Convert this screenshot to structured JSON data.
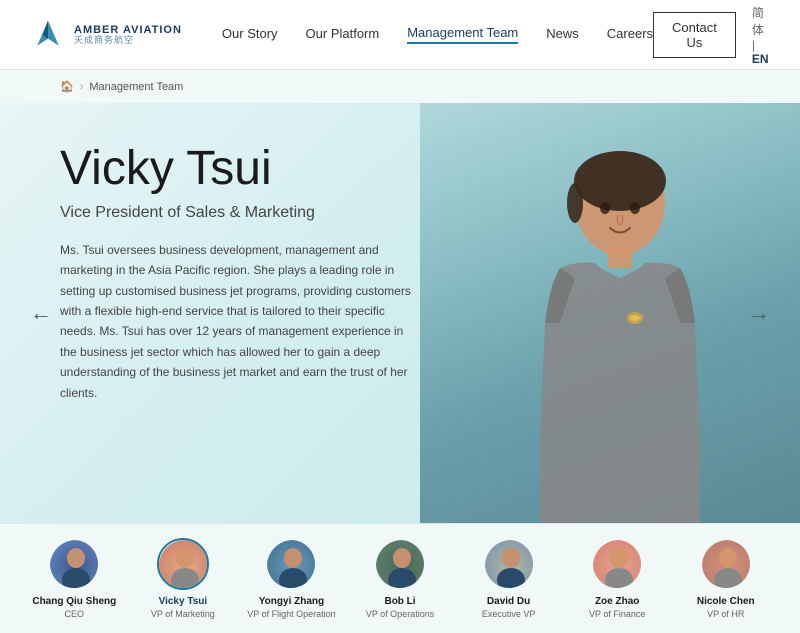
{
  "header": {
    "logo_en": "AMBER AVIATION",
    "logo_cn": "天成商务航空",
    "nav_items": [
      {
        "label": "Our Story",
        "active": false
      },
      {
        "label": "Our Platform",
        "active": false
      },
      {
        "label": "Management Team",
        "active": true
      },
      {
        "label": "News",
        "active": false
      },
      {
        "label": "Careers",
        "active": false
      }
    ],
    "contact_btn": "Contact Us",
    "lang_cn": "简体",
    "lang_sep": "|",
    "lang_en": "EN"
  },
  "breadcrumb": {
    "home": "🏠",
    "sep": ">",
    "current": "Management Team"
  },
  "profile": {
    "name": "Vicky Tsui",
    "title": "Vice President of Sales & Marketing",
    "bio": "Ms. Tsui oversees business development, management and marketing in the Asia Pacific region. She plays a leading role in setting up customised business jet programs, providing customers with a flexible high-end service that is tailored to their specific needs. Ms. Tsui has over 12 years of management experience in the business jet sector which has allowed her to gain a deep understanding of the business jet market and earn the trust of her clients."
  },
  "team": [
    {
      "name": "Chang Qiu Sheng",
      "role": "CEO",
      "av_class": "av-1",
      "active": false
    },
    {
      "name": "Vicky Tsui",
      "role": "VP of Marketing",
      "av_class": "av-2",
      "active": true
    },
    {
      "name": "Yongyi Zhang",
      "role": "VP of Flight Operation",
      "av_class": "av-3",
      "active": false
    },
    {
      "name": "Bob Li",
      "role": "VP of Operations",
      "av_class": "av-4",
      "active": false
    },
    {
      "name": "David Du",
      "role": "Executive VP",
      "av_class": "av-5",
      "active": false
    },
    {
      "name": "Zoe Zhao",
      "role": "VP of Finance",
      "av_class": "av-6",
      "active": false
    },
    {
      "name": "Nicole Chen",
      "role": "VP of HR",
      "av_class": "av-7",
      "active": false
    }
  ]
}
